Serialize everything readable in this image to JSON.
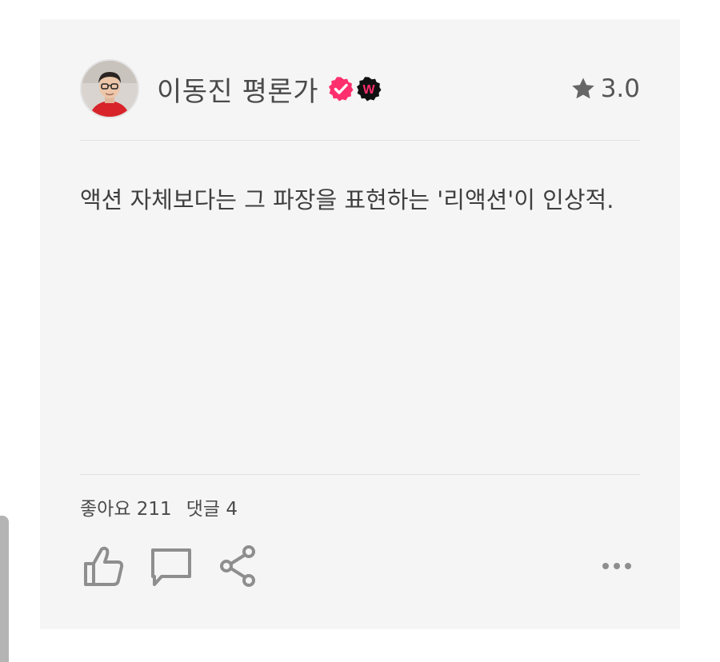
{
  "review": {
    "author": "이동진 평론가",
    "rating": "3.0",
    "text": "액션 자체보다는 그 파장을 표현하는 '리액션'이 인상적.",
    "likes": "좋아요 211",
    "comments": "댓글 4"
  },
  "badges": {
    "verified_color": "#ff2f6e",
    "watcha_color": "#111111",
    "watcha_letter": "W"
  },
  "icons": {
    "star": "star-icon",
    "like": "thumbs-up-icon",
    "comment": "speech-bubble-icon",
    "share": "share-icon",
    "more": "more-horizontal-icon"
  }
}
